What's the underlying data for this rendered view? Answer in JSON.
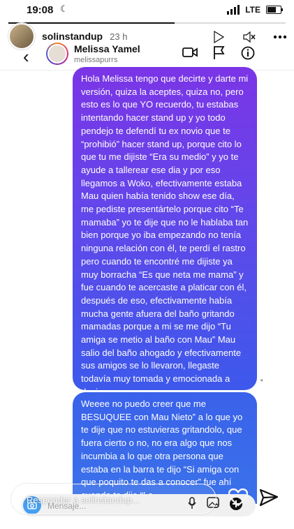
{
  "status": {
    "time": "19:08",
    "network": "LTE"
  },
  "story": {
    "username": "solinstandup",
    "age": "23 h",
    "progress": 0.6
  },
  "dm": {
    "name": "Melissa Yamel",
    "handle": "melissapurrs"
  },
  "messages": [
    {
      "text": "Hola Melissa tengo que decirte y darte mi versión, quiza la aceptes, quiza no, pero esto es lo que YO recuerdo, tu estabas intentando hacer stand up y yo todo pendejo te defendí tu ex novio que te “prohibió” hacer stand up, porque cito lo que tu me dijiste “Era su medio” y yo te ayude a tallerear ese dia y por eso llegamos a Woko, efectivamente estaba Mau quien había tenido show ese día, me pediste presentártelo porque cito “Te mamaba” yo te dije que no le hablaba tan bien porque yo iba empezando no tenía ninguna relación con él, te perdí el rastro pero cuando te encontré me dijiste ya muy borracha “Es que neta me mama” y fue cuando te acercaste a platicar con él, después de eso, efectivamente había mucha gente afuera del baño gritando mamadas porque a mi se me dijo “Tu amiga se metio al baño con Mau” Mau salio del baño ahogado y efectivamente sus amigos se lo llevaron, llegaste todavía muy tomada y emocionada a decirme"
    },
    {
      "text": "Weeee no puedo creer que me BESUQUEE con Mau Nieto” a lo que yo te dije que no estuvieras gritandolo, que fuera cierto o no, no era algo que nos incumbia a lo que otra persona que estaba en la barra te dijo “Si amiga con que poquito te das a conocer” fue ahí cuando te dije “La"
    }
  ],
  "composer": {
    "placeholder": "Mensaje..."
  },
  "reply": {
    "placeholder": "Responder a solinstandup..."
  },
  "colors": {
    "bubble_top": "#7b35e6",
    "bubble_bottom": "#3a72ea",
    "accent": "#3797f0"
  }
}
